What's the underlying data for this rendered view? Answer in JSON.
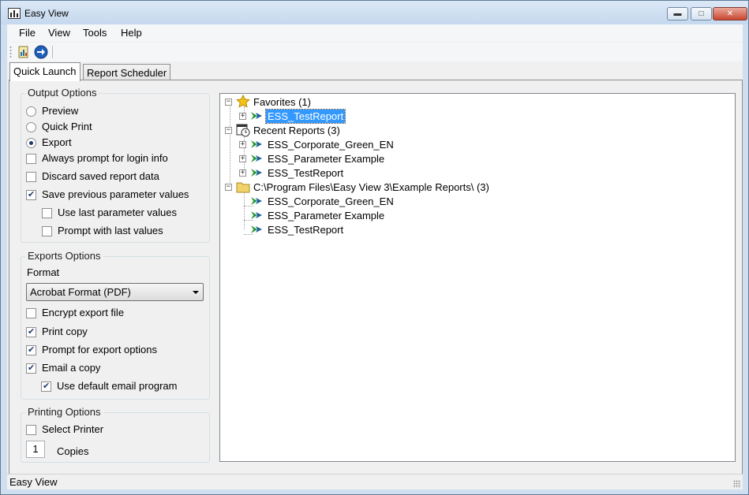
{
  "window": {
    "title": "Easy View"
  },
  "menu": [
    "File",
    "View",
    "Tools",
    "Help"
  ],
  "toolbar": {
    "buttons": [
      "report-icon",
      "go-icon"
    ]
  },
  "tabs": [
    "Quick Launch",
    "Report Scheduler"
  ],
  "output_options": {
    "title": "Output Options",
    "radios": [
      {
        "label": "Preview",
        "checked": false
      },
      {
        "label": "Quick Print",
        "checked": false
      },
      {
        "label": "Export",
        "checked": true
      }
    ],
    "checks": [
      {
        "label": "Always prompt for login info",
        "checked": false
      },
      {
        "label": "Discard saved report data",
        "checked": false
      },
      {
        "label": "Save previous parameter values",
        "checked": true
      },
      {
        "label": "Use last parameter values",
        "checked": false
      },
      {
        "label": "Prompt with last values",
        "checked": false
      }
    ]
  },
  "exports_options": {
    "title": "Exports Options",
    "format_label": "Format",
    "format_value": "Acrobat Format (PDF)",
    "checks": [
      {
        "label": "Encrypt export file",
        "checked": false
      },
      {
        "label": "Print copy",
        "checked": true
      },
      {
        "label": "Prompt for export options",
        "checked": true
      },
      {
        "label": "Email a copy",
        "checked": true
      },
      {
        "label": "Use default email program",
        "checked": true
      }
    ]
  },
  "printing_options": {
    "title": "Printing Options",
    "select_printer": {
      "label": "Select Printer",
      "checked": false
    },
    "copies_value": "1",
    "copies_label": "Copies"
  },
  "tree": {
    "favorites": {
      "label": "Favorites (1)",
      "children": [
        "ESS_TestReport"
      ]
    },
    "recent": {
      "label": "Recent Reports (3)",
      "children": [
        "ESS_Corporate_Green_EN",
        "ESS_Parameter Example",
        "ESS_TestReport"
      ]
    },
    "folder": {
      "label": "C:\\Program Files\\Easy View 3\\Example Reports\\ (3)",
      "children": [
        "ESS_Corporate_Green_EN",
        "ESS_Parameter Example",
        "ESS_TestReport"
      ]
    }
  },
  "status": {
    "text": "Easy View"
  },
  "colors": {
    "selection": "#3399ff",
    "titlebar": "#c5d8ee",
    "close_button": "#c9462f"
  }
}
